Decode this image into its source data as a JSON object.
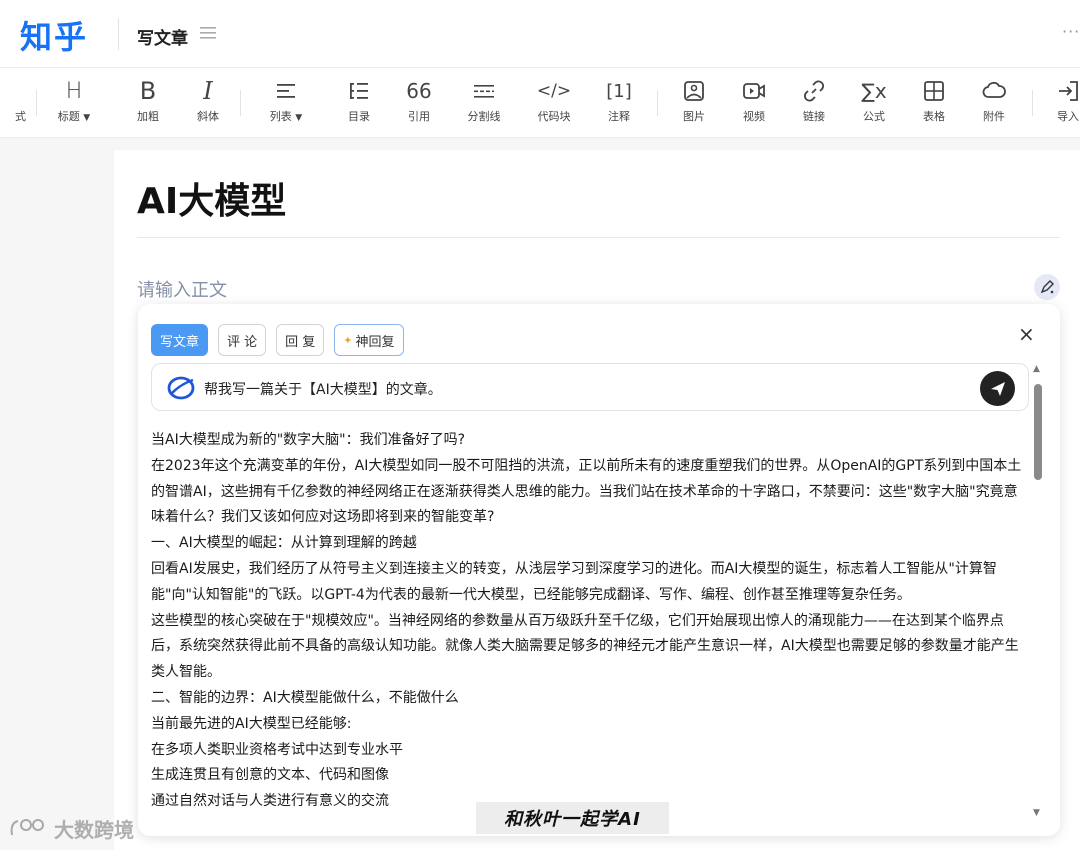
{
  "header": {
    "logo": "知乎",
    "page_label": "写文章",
    "more": "···"
  },
  "toolbar": {
    "partial_left": "式",
    "items": [
      {
        "label": "标题",
        "icon": "heading-icon",
        "glyph": "H",
        "dropdown": true
      },
      {
        "label": "加粗",
        "icon": "bold-icon",
        "glyph": "B"
      },
      {
        "label": "斜体",
        "icon": "italic-icon",
        "glyph": "I"
      },
      {
        "label": "列表",
        "icon": "list-icon",
        "glyph": "≡",
        "dropdown": true
      },
      {
        "label": "目录",
        "icon": "toc-icon",
        "glyph": "☰"
      },
      {
        "label": "引用",
        "icon": "quote-icon",
        "glyph": "66"
      },
      {
        "label": "分割线",
        "icon": "divider-icon",
        "glyph": "┄"
      },
      {
        "label": "代码块",
        "icon": "code-icon",
        "glyph": "</>"
      },
      {
        "label": "注释",
        "icon": "footnote-icon",
        "glyph": "[1]"
      },
      {
        "label": "图片",
        "icon": "image-icon",
        "glyph": ""
      },
      {
        "label": "视频",
        "icon": "video-icon",
        "glyph": ""
      },
      {
        "label": "链接",
        "icon": "link-icon",
        "glyph": ""
      },
      {
        "label": "公式",
        "icon": "formula-icon",
        "glyph": "∑x"
      },
      {
        "label": "表格",
        "icon": "table-icon",
        "glyph": ""
      },
      {
        "label": "附件",
        "icon": "attachment-icon",
        "glyph": ""
      },
      {
        "label": "导入",
        "icon": "import-icon",
        "glyph": ""
      }
    ]
  },
  "editor": {
    "title": "AI大模型",
    "body_placeholder": "请输入正文"
  },
  "ai_panel": {
    "tabs": [
      {
        "label": "写文章",
        "active": true
      },
      {
        "label": "评 论",
        "active": false
      },
      {
        "label": "回 复",
        "active": false
      },
      {
        "label": "神回复",
        "active": false
      }
    ],
    "close": "×",
    "prompt": "帮我写一篇关于【AI大模型】的文章。",
    "article": [
      "当AI大模型成为新的\"数字大脑\"：我们准备好了吗?",
      "在2023年这个充满变革的年份，AI大模型如同一股不可阻挡的洪流，正以前所未有的速度重塑我们的世界。从OpenAI的GPT系列到中国本土的智谱AI，这些拥有千亿参数的神经网络正在逐渐获得类人思维的能力。当我们站在技术革命的十字路口，不禁要问：这些\"数字大脑\"究竟意味着什么？我们又该如何应对这场即将到来的智能变革?",
      "一、AI大模型的崛起：从计算到理解的跨越",
      "回看AI发展史，我们经历了从符号主义到连接主义的转变，从浅层学习到深度学习的进化。而AI大模型的诞生，标志着人工智能从\"计算智能\"向\"认知智能\"的飞跃。以GPT-4为代表的最新一代大模型，已经能够完成翻译、写作、编程、创作甚至推理等复杂任务。",
      "这些模型的核心突破在于\"规模效应\"。当神经网络的参数量从百万级跃升至千亿级，它们开始展现出惊人的涌现能力——在达到某个临界点后，系统突然获得此前不具备的高级认知功能。就像人类大脑需要足够多的神经元才能产生意识一样，AI大模型也需要足够的参数量才能产生类人智能。",
      "二、智能的边界：AI大模型能做什么，不能做什么",
      "当前最先进的AI大模型已经能够:",
      "在多项人类职业资格考试中达到专业水平",
      "生成连贯且有创意的文本、代码和图像",
      "通过自然对话与人类进行有意义的交流"
    ]
  },
  "watermarks": {
    "left": "大数跨境",
    "right": "和秋叶一起学AI"
  },
  "colors": {
    "brand": "#1772f6",
    "active_tab": "#4a9af4"
  }
}
